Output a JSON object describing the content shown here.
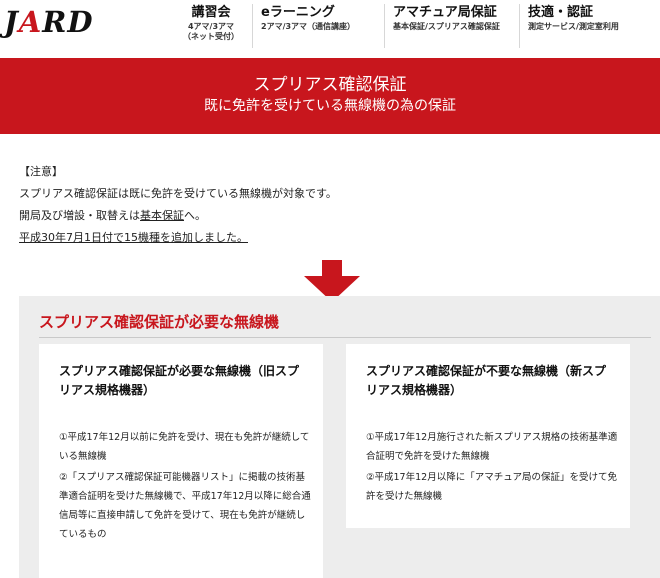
{
  "header": {
    "logo_pre": "J",
    "logo_a": "A",
    "logo_post": "RD",
    "nav": [
      {
        "title": "講習会",
        "sub": "4アマ/3アマ\n（ネット受付）"
      },
      {
        "title": "eラーニング",
        "sub": "2アマ/3アマ（通信講座）"
      },
      {
        "title": "アマチュア局保証",
        "sub": "基本保証/スプリアス確認保証"
      },
      {
        "title": "技適・認証",
        "sub": "測定サービス/測定室利用"
      }
    ]
  },
  "banner": {
    "title": "スプリアス確認保証",
    "subtitle": "既に免許を受けている無線機の為の保証"
  },
  "notice": {
    "heading": "【注意】",
    "line1": "スプリアス確認保証は既に免許を受けている無線機が対象です。",
    "line2_pre": "開局及び増設・取替えは",
    "line2_link": "基本保証",
    "line2_post": "へ。",
    "line3_link": "平成30年7月1日付で15機種を追加しました。"
  },
  "section": {
    "title": "スプリアス確認保証が必要な無線機",
    "cards": [
      {
        "title": "スプリアス確認保証が必要な無線機（旧スプリアス規格機器）",
        "items": [
          "①平成17年12月以前に免許を受け、現在も免許が継続している無線機",
          "②「スプリアス確認保証可能機器リスト」に掲載の技術基準適合証明を受けた無線機で、平成17年12月以降に総合通信局等に直接申請して免許を受けて、現在も免許が継続しているもの"
        ]
      },
      {
        "title": "スプリアス確認保証が不要な無線機（新スプリアス規格機器）",
        "items": [
          "①平成17年12月施行された新スプリアス規格の技術基準適合証明で免許を受けた無線機",
          "②平成17年12月以降に「アマチュア局の保証」を受けて免許を受けた無線機"
        ]
      }
    ]
  },
  "colors": {
    "brand_red": "#c8161d",
    "section_bg": "#ededed"
  }
}
